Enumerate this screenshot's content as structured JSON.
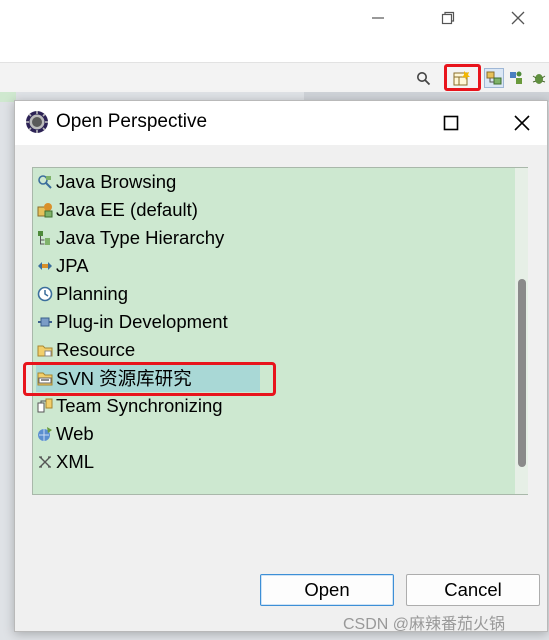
{
  "window_controls": {
    "minimize_icon": "minimize-icon",
    "restore_icon": "restore-icon",
    "close_icon": "close-icon"
  },
  "toolbar": {
    "icons": [
      "search-icon",
      "open-perspective-icon",
      "java-perspective-icon",
      "debug-perspective-icon"
    ]
  },
  "dialog": {
    "title": "Open Perspective",
    "perspectives": [
      {
        "label": "Java Browsing",
        "icon": "java-browsing-icon"
      },
      {
        "label": "Java EE (default)",
        "icon": "java-ee-icon"
      },
      {
        "label": "Java Type Hierarchy",
        "icon": "type-hierarchy-icon"
      },
      {
        "label": "JPA",
        "icon": "jpa-icon"
      },
      {
        "label": "Planning",
        "icon": "planning-icon"
      },
      {
        "label": "Plug-in Development",
        "icon": "plugin-icon"
      },
      {
        "label": "Resource",
        "icon": "resource-icon"
      },
      {
        "label": "SVN 资源库研究",
        "icon": "svn-icon",
        "selected": true
      },
      {
        "label": "Team Synchronizing",
        "icon": "team-sync-icon"
      },
      {
        "label": "Web",
        "icon": "web-icon"
      },
      {
        "label": "XML",
        "icon": "xml-icon"
      }
    ],
    "open_label": "Open",
    "cancel_label": "Cancel"
  },
  "watermark": "CSDN @麻辣番茄火锅",
  "colors": {
    "list_background": "#cde8d0",
    "selected_row": "#a9d8d6",
    "highlight_red": "#e8141c",
    "default_button_border": "#3d8fd6"
  }
}
